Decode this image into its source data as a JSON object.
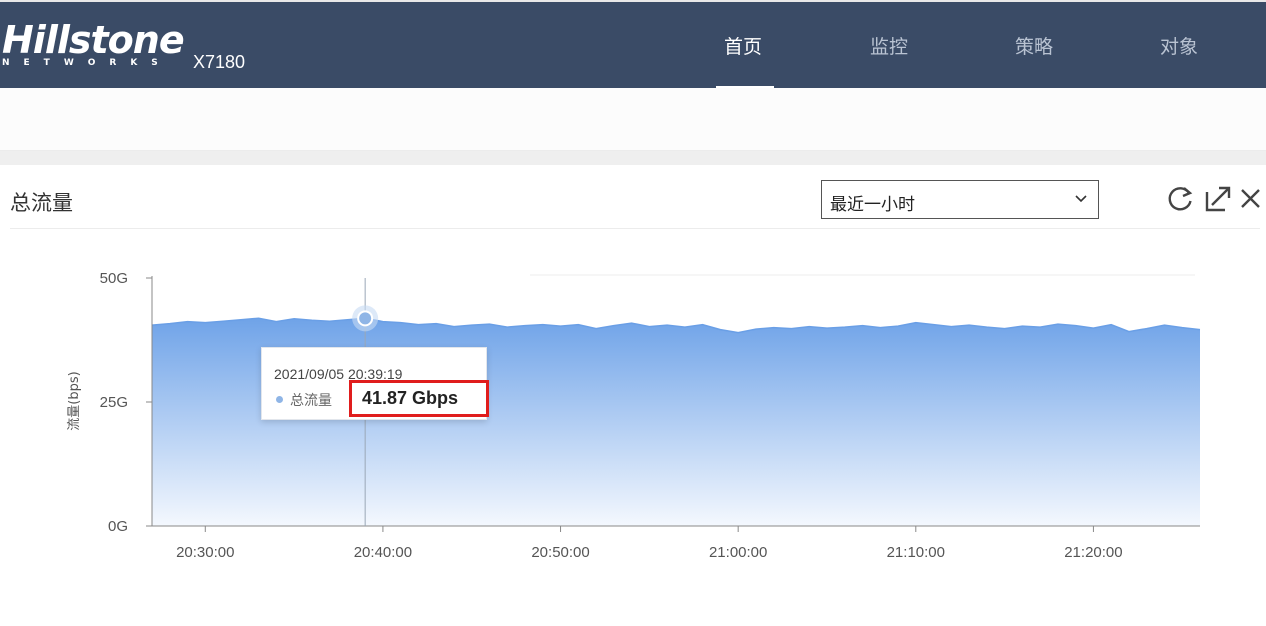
{
  "header": {
    "brand": "Hillstone",
    "brand_sub": "NETWORKS",
    "model": "X7180",
    "nav": [
      {
        "label": "首页",
        "active": true
      },
      {
        "label": "监控",
        "active": false
      },
      {
        "label": "策略",
        "active": false
      },
      {
        "label": "对象",
        "active": false
      }
    ]
  },
  "panel": {
    "title": "总流量",
    "time_range": "最近一小时",
    "tools": [
      "refresh-icon",
      "expand-icon",
      "close-icon"
    ]
  },
  "tooltip": {
    "time": "2021/09/05 20:39:19",
    "series": "总流量",
    "value": "41.87 Gbps"
  },
  "chart_data": {
    "type": "area",
    "ylabel": "流量(bps)",
    "y_ticks": [
      "50G",
      "25G",
      "0G"
    ],
    "ylim": [
      0,
      50
    ],
    "y_unit": "Gbps",
    "x_ticks": [
      "20:30:00",
      "20:40:00",
      "20:50:00",
      "21:00:00",
      "21:10:00",
      "21:20:00"
    ],
    "x": [
      "20:27",
      "20:28",
      "20:29",
      "20:30",
      "20:31",
      "20:32",
      "20:33",
      "20:34",
      "20:35",
      "20:36",
      "20:37",
      "20:38",
      "20:39",
      "20:40",
      "20:41",
      "20:42",
      "20:43",
      "20:44",
      "20:45",
      "20:46",
      "20:47",
      "20:48",
      "20:49",
      "20:50",
      "20:51",
      "20:52",
      "20:53",
      "20:54",
      "20:55",
      "20:56",
      "20:57",
      "20:58",
      "20:59",
      "21:00",
      "21:01",
      "21:02",
      "21:03",
      "21:04",
      "21:05",
      "21:06",
      "21:07",
      "21:08",
      "21:09",
      "21:10",
      "21:11",
      "21:12",
      "21:13",
      "21:14",
      "21:15",
      "21:16",
      "21:17",
      "21:18",
      "21:19",
      "21:20",
      "21:21",
      "21:22",
      "21:23",
      "21:24",
      "21:25",
      "21:26"
    ],
    "series": [
      {
        "name": "总流量",
        "values": [
          40.5,
          40.8,
          41.2,
          41.0,
          41.3,
          41.6,
          41.9,
          41.2,
          41.8,
          41.5,
          41.3,
          41.6,
          41.87,
          41.2,
          41.0,
          40.6,
          40.8,
          40.2,
          40.5,
          40.7,
          40.1,
          40.4,
          40.6,
          40.3,
          40.6,
          39.8,
          40.4,
          40.9,
          40.2,
          40.5,
          40.1,
          40.6,
          39.6,
          39.0,
          39.7,
          40.0,
          39.8,
          40.2,
          39.9,
          40.1,
          40.4,
          40.0,
          40.3,
          41.0,
          40.6,
          40.2,
          40.5,
          40.1,
          39.8,
          40.3,
          40.1,
          40.7,
          40.4,
          39.9,
          40.6,
          39.2,
          39.8,
          40.5,
          40.0,
          39.6
        ]
      }
    ],
    "highlight": {
      "x": "20:39",
      "value": 41.87
    },
    "colors": {
      "area_top": "#6fa3e8",
      "area_bottom": "#f4f8fe",
      "line": "#6a9fe6"
    }
  }
}
